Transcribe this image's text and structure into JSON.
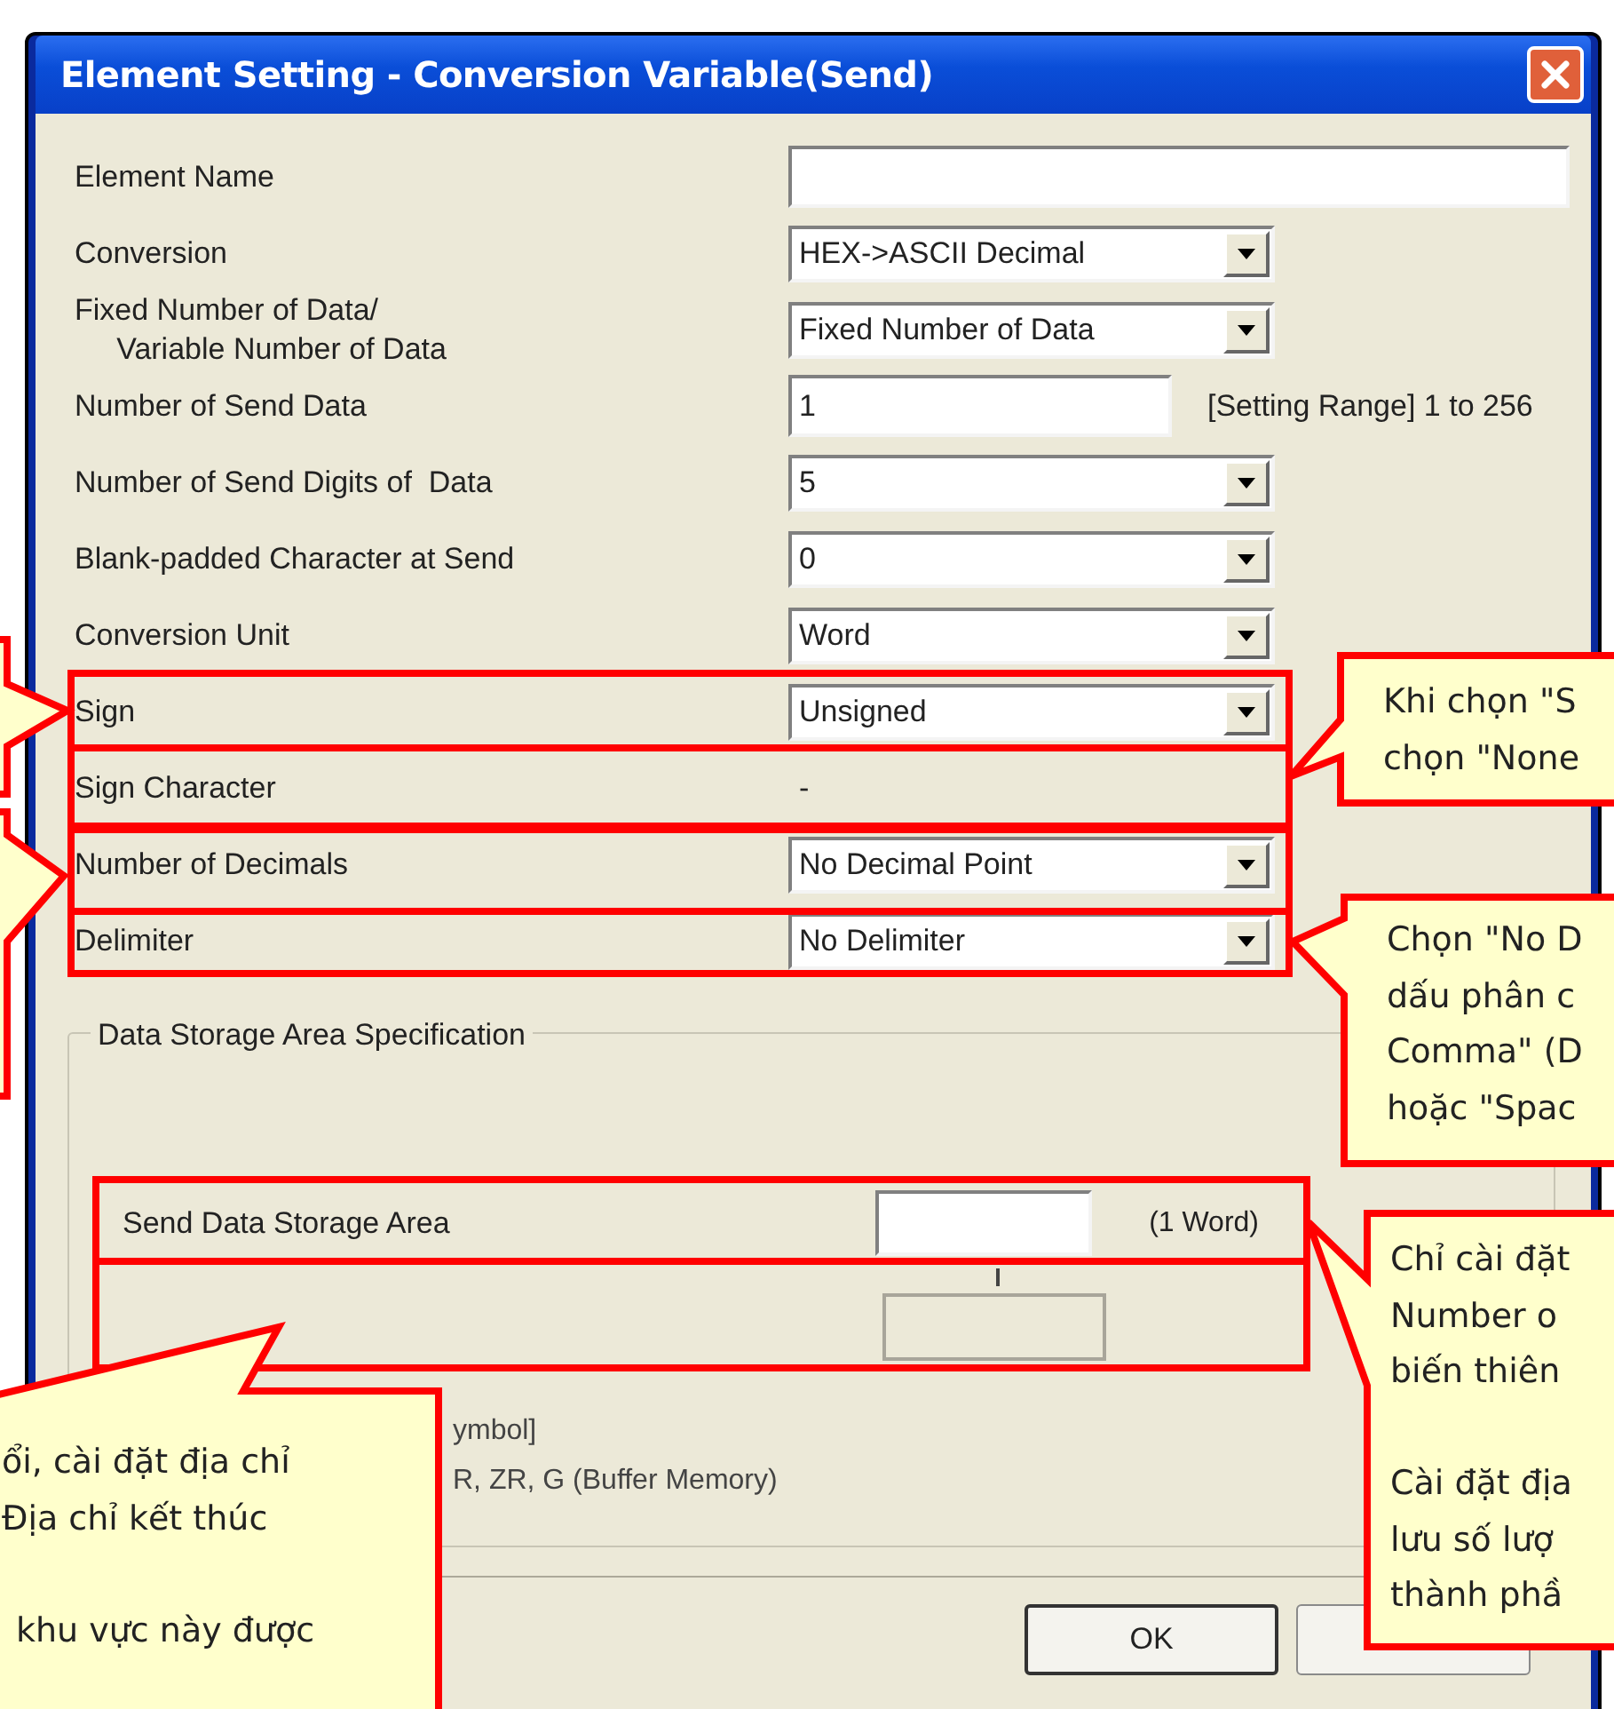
{
  "window": {
    "title": "Element Setting - Conversion Variable(Send)"
  },
  "fields": [
    {
      "kind": "text",
      "label": "Element Name"
    },
    {
      "kind": "dropdown",
      "label": "Conversion",
      "value": "HEX->ASCII Decimal"
    },
    {
      "kind": "dropdown",
      "label": "Fixed Number of Data/\n     Variable Number of Data",
      "value": "Fixed Number of Data"
    },
    {
      "kind": "text",
      "label": "Number of Send Data",
      "value": "1",
      "note": "[Setting Range] 1 to 256"
    },
    {
      "kind": "dropdown",
      "label": "Number of Send Digits of  Data",
      "value": "5"
    },
    {
      "kind": "dropdown",
      "label": "Blank-padded Character at Send",
      "value": "0"
    },
    {
      "kind": "dropdown",
      "label": "Conversion Unit",
      "value": "Word"
    },
    {
      "kind": "dropdown",
      "label": "Sign",
      "value": "Unsigned"
    },
    {
      "kind": "readonly",
      "label": "Sign Character",
      "value": "-"
    },
    {
      "kind": "dropdown",
      "label": "Number of Decimals",
      "value": "No Decimal Point"
    },
    {
      "kind": "dropdown",
      "label": "Delimiter",
      "value": "No Delimiter"
    }
  ],
  "storage_group": {
    "title": "Data Storage Area Specification",
    "area_label": "Send Data Storage Area",
    "area_note": "(1 Word)",
    "hint_lines": [
      "ymbol]",
      "R, ZR, G (Buffer Memory)"
    ]
  },
  "buttons": [
    {
      "label": "OK"
    }
  ],
  "callouts": [
    {
      "kind": "blank"
    },
    {
      "kind": "blank"
    },
    {
      "kind": "note",
      "paragraphs": [
        "Khi chọn \"S\nchọn \"None"
      ]
    },
    {
      "kind": "note",
      "paragraphs": [
        "Chọn \"No D\ndấu phân c\nComma\" (D\nhoặc \"Spac"
      ]
    },
    {
      "kind": "note",
      "paragraphs": [
        "Chỉ cài đặt\nNumber o\nbiến thiên",
        "Cài đặt địa\nlưu số lượ\nthành phầ"
      ]
    },
    {
      "kind": "note",
      "paragraphs": [
        "ổi, cài đặt địa chỉ\nĐịa chỉ kết thúc",
        "khu vực này được"
      ]
    }
  ]
}
